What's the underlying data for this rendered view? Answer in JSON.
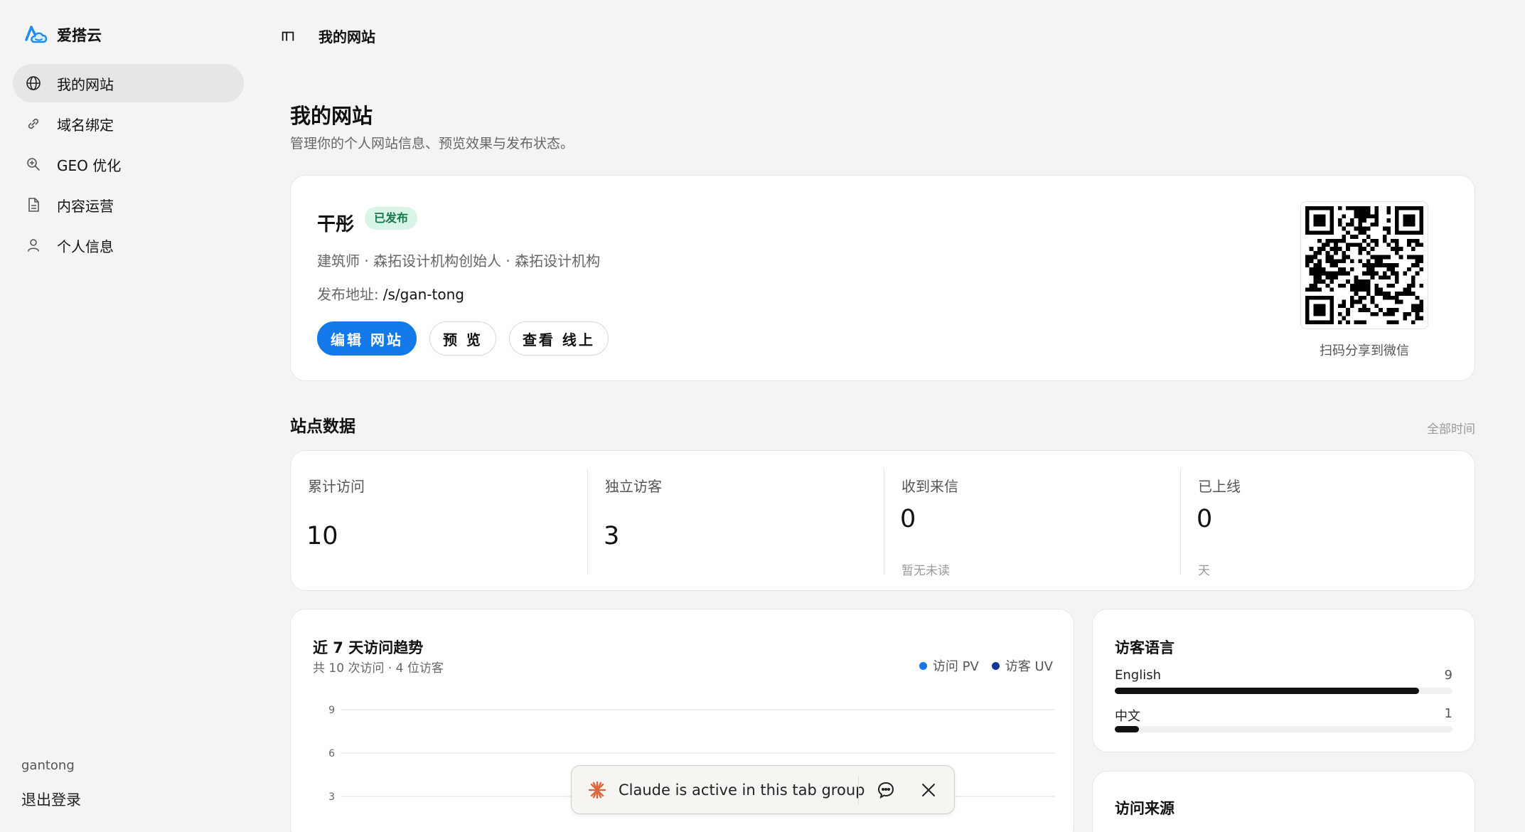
{
  "app": {
    "name": "爱搭云"
  },
  "sidebar": {
    "items": [
      {
        "label": "我的网站",
        "icon": "globe-icon",
        "active": true
      },
      {
        "label": "域名绑定",
        "icon": "link-icon",
        "active": false
      },
      {
        "label": "GEO 优化",
        "icon": "zoom-in-icon",
        "active": false
      },
      {
        "label": "内容运营",
        "icon": "document-icon",
        "active": false
      },
      {
        "label": "个人信息",
        "icon": "user-icon",
        "active": false
      }
    ],
    "user": "gantong",
    "logout": "退出登录"
  },
  "topbar": {
    "title": "我的网站"
  },
  "page": {
    "title": "我的网站",
    "subtitle": "管理你的个人网站信息、预览效果与发布状态。"
  },
  "profile": {
    "name": "干彤",
    "status": "已发布",
    "meta": "建筑师 · 森拓设计机构创始人 · 森拓设计机构",
    "url_label": "发布地址:",
    "url": "/s/gan-tong",
    "buttons": {
      "edit": "编辑 网站",
      "preview": "预 览",
      "view": "查看 线上"
    },
    "qr_caption": "扫码分享到微信"
  },
  "stats": {
    "title": "站点数据",
    "range": "全部时间",
    "items": [
      {
        "label": "累计访问",
        "value": "10",
        "note": ""
      },
      {
        "label": "独立访客",
        "value": "3",
        "note": ""
      },
      {
        "label": "收到来信",
        "value": "0",
        "note": "暂无未读"
      },
      {
        "label": "已上线",
        "value": "0",
        "note": "天"
      }
    ]
  },
  "trend": {
    "title": "近 7 天访问趋势",
    "subtitle": "共 10 次访问 · 4 位访客",
    "legend": [
      {
        "label": "访问 PV",
        "color": "#1479e8"
      },
      {
        "label": "访客 UV",
        "color": "#12369c"
      }
    ]
  },
  "chart_data": {
    "type": "line",
    "ylim": [
      0,
      12
    ],
    "yticks": [
      "12",
      "9",
      "6",
      "3"
    ],
    "series": [
      {
        "name": "访问 PV",
        "values": []
      },
      {
        "name": "访客 UV",
        "values": []
      }
    ]
  },
  "languages": {
    "title": "访客语言",
    "items": [
      {
        "name": "English",
        "count": "9",
        "fraction": 0.9
      },
      {
        "name": "中文",
        "count": "1",
        "fraction": 0.072
      }
    ]
  },
  "sources": {
    "title": "访问来源"
  },
  "toast": {
    "text": "Claude is active in this tab group"
  },
  "colors": {
    "accent": "#1479e8",
    "badge_bg": "#d8f5e7",
    "badge_text": "#17774a",
    "claude": "#d9683e"
  }
}
